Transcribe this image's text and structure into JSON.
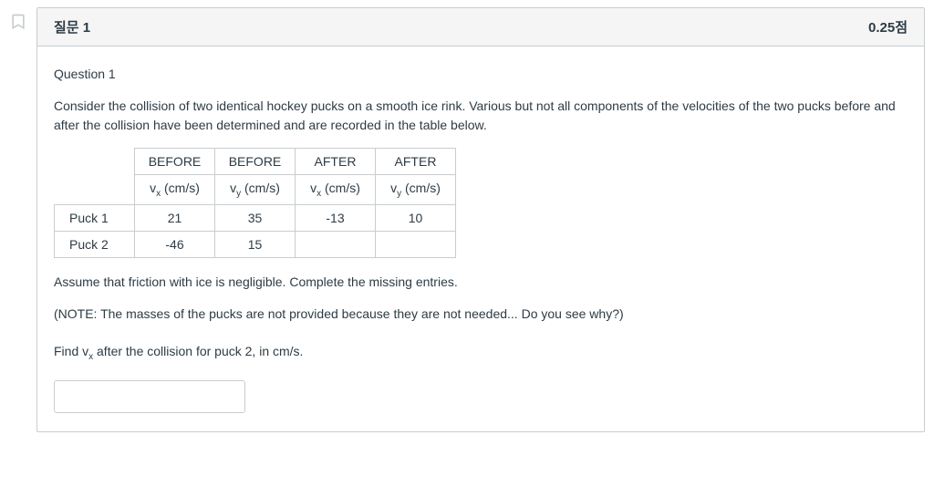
{
  "header": {
    "title": "질문 1",
    "points": "0.25점"
  },
  "body": {
    "question_label": "Question 1",
    "prompt": "Consider the collision of two identical hockey pucks on a smooth ice rink. Various but not all components of the velocities of the two pucks before and after the collision have been determined and are recorded in the table below.",
    "assume_text": "Assume that friction with ice is negligible. Complete the missing entries.",
    "note_text": "(NOTE: The masses of the pucks are not provided because they are not needed... Do you see why?)",
    "find_prompt_pre": "Find v",
    "find_prompt_sub": "x",
    "find_prompt_post": " after the collision for puck 2, in cm/s."
  },
  "table": {
    "col_headers_top": [
      "BEFORE",
      "BEFORE",
      "AFTER",
      "AFTER"
    ],
    "col_unit_prefix": "v",
    "col_unit_subs": [
      "x",
      "y",
      "x",
      "y"
    ],
    "col_unit_suffix": " (cm/s)",
    "rows": [
      {
        "label": "Puck 1",
        "cells": [
          "21",
          "35",
          "-13",
          "10"
        ]
      },
      {
        "label": "Puck 2",
        "cells": [
          "-46",
          "15",
          "",
          ""
        ]
      }
    ]
  },
  "answer": {
    "value": ""
  }
}
